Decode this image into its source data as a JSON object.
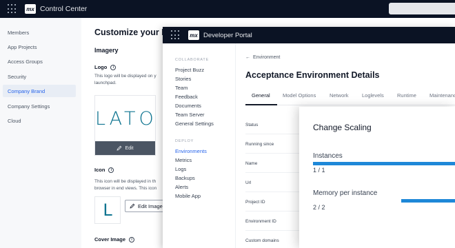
{
  "control_center": {
    "title": "Control Center",
    "sidebar": [
      {
        "label": "Members",
        "active": false
      },
      {
        "label": "App Projects",
        "active": false
      },
      {
        "label": "Access Groups",
        "active": false
      },
      {
        "label": "Security",
        "active": false
      },
      {
        "label": "Company Brand",
        "active": true
      },
      {
        "label": "Company Settings",
        "active": false
      },
      {
        "label": "Cloud",
        "active": false
      }
    ],
    "heading": "Customize your Brand",
    "imagery": "Imagery",
    "logo": {
      "label": "Logo",
      "desc_line1": "This logo will be displayed on y",
      "desc_line2": "launchpad.",
      "preview": "LATO",
      "edit_label": "Edit"
    },
    "icon": {
      "label": "Icon",
      "desc_line1": "This icon will be displayed in th",
      "desc_line2": "browser in end views. This icon",
      "preview": "L",
      "edit_label": "Edit Image"
    },
    "cover_image_label": "Cover Image"
  },
  "developer_portal": {
    "title": "Developer Portal",
    "sections": [
      {
        "title": "COLLABORATE",
        "links": [
          "Project Buzz",
          "Stories",
          "Team",
          "Feedback",
          "Documents",
          "Team Server",
          "General Settings"
        ]
      },
      {
        "title": "DEPLOY",
        "links": [
          "Environments",
          "Metrics",
          "Logs",
          "Backups",
          "Alerts",
          "Mobile App"
        ]
      }
    ],
    "active_link": "Environments",
    "back_label": "Environment",
    "heading": "Acceptance Environment Details",
    "tabs": [
      "General",
      "Model Options",
      "Network",
      "Loglevels",
      "Runtime",
      "Maintenance"
    ],
    "active_tab": "General",
    "detail_rows": [
      "Status",
      "Running since",
      "Name",
      "Url",
      "Project ID",
      "Environment ID",
      "Custom domains"
    ]
  },
  "scaling": {
    "title": "Change Scaling",
    "instances_label": "Instances",
    "instances_value": "1 / 1",
    "instances_fill": 1.0,
    "memory_label": "Memory per instance",
    "memory_value": "2 / 2",
    "memory_fill": 1.0,
    "accent": "#1e88d8"
  }
}
